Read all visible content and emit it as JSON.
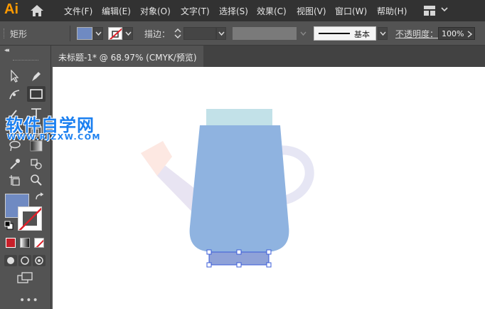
{
  "app": {
    "logo": "Ai",
    "home_icon": "home-icon"
  },
  "menu": [
    {
      "label": "文件(F)"
    },
    {
      "label": "编辑(E)"
    },
    {
      "label": "对象(O)"
    },
    {
      "label": "文字(T)"
    },
    {
      "label": "选择(S)"
    },
    {
      "label": "效果(C)"
    },
    {
      "label": "视图(V)"
    },
    {
      "label": "窗口(W)"
    },
    {
      "label": "帮助(H)"
    }
  ],
  "control": {
    "object_type": "矩形",
    "stroke_label": "描边：",
    "profile": "基本",
    "opacity_label": "不透明度：",
    "opacity_value": "100%",
    "fill_color": "#6f8ac2"
  },
  "document": {
    "tab_title": "未标题-1* @ 68.97% (CMYK/预览)"
  },
  "watermark": {
    "title": "软件自学网",
    "url": "WWW.RJZXW.COM"
  },
  "colors": {
    "body": "#8fb3e0",
    "lid": "#c2e1e8",
    "handle": "#e6e6f4",
    "spout": "#e8e4f2",
    "spout_tip": "#fde8e2",
    "selected_rect": "#8fa2d8",
    "selection": "#3a5bd8"
  }
}
